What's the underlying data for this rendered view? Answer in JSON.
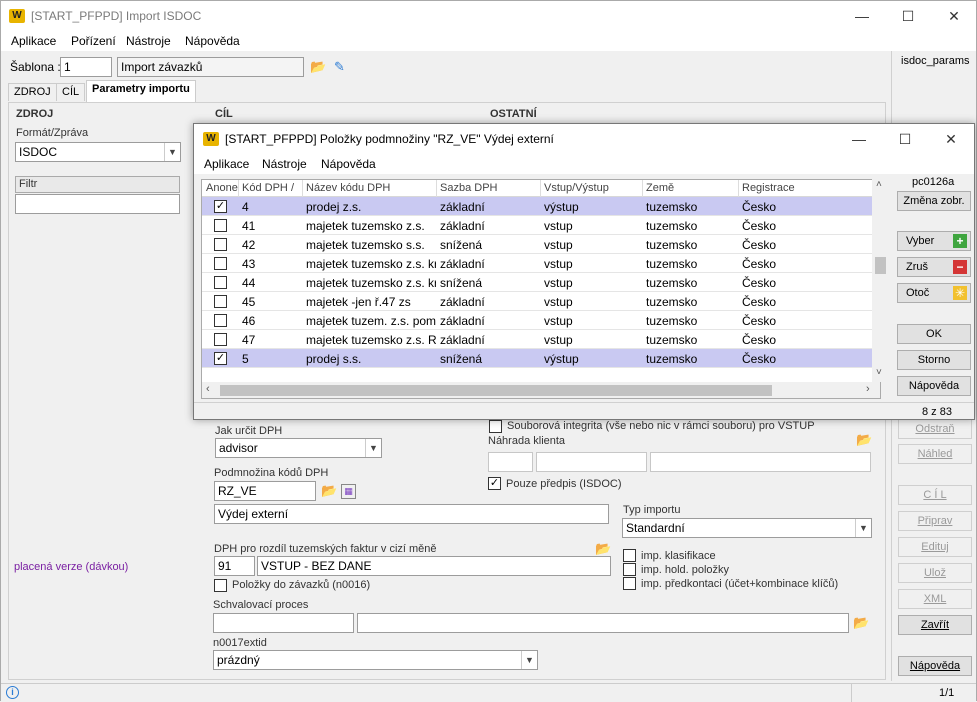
{
  "window": {
    "title": "[START_PFPPD] Import ISDOC",
    "logo": "W"
  },
  "menu": [
    "Aplikace",
    "Pořízení",
    "Nástroje",
    "Nápověda"
  ],
  "template": {
    "label": "Šablona :",
    "number": "1",
    "name": "Import závazků"
  },
  "right_top_label": "isdoc_params",
  "tabs": [
    "ZDROJ",
    "CÍL",
    "Parametry importu"
  ],
  "sections": {
    "zdroj": "ZDROJ",
    "cil": "CÍL",
    "ostatni": "OSTATNÍ"
  },
  "format": {
    "label": "Formát/Zpráva",
    "value": "ISDOC"
  },
  "filter": {
    "label": "Filtr",
    "value": ""
  },
  "paid_version": "placená verze (dávkou)",
  "dph_method": {
    "label": "Jak určit DPH",
    "value": "advisor"
  },
  "dph_subset": {
    "label": "Podmnožina kódů DPH",
    "code": "RZ_VE",
    "name": "Výdej externí"
  },
  "integrity": {
    "label": "Souborová integrita (vše nebo nic v rámci souboru) pro VSTUP",
    "checked": false
  },
  "client_replace": {
    "label": "Náhrada klienta",
    "v1": "",
    "v2": "",
    "v3": ""
  },
  "prescription_only": {
    "label": "Pouze předpis (ISDOC)",
    "checked": true
  },
  "import_type": {
    "label": "Typ importu",
    "value": "Standardní"
  },
  "foreign_dph": {
    "label": "DPH pro rozdíl tuzemských faktur v cizí měně",
    "code": "91",
    "name": "VSTUP  - BEZ DANE"
  },
  "items_to_invoices": {
    "label": "Položky do závazků (n0016)",
    "checked": false
  },
  "imp_checks": [
    {
      "label": "imp. klasifikace",
      "checked": false
    },
    {
      "label": "imp. hold. položky",
      "checked": false
    },
    {
      "label": "imp. předkontaci (účet+kombinace klíčů)",
      "checked": false
    }
  ],
  "approval": {
    "label": "Schvalovací proces",
    "v1": "",
    "v2": ""
  },
  "extid": {
    "label": "n0017extid",
    "value": "prázdný"
  },
  "right_buttons": {
    "odstran": "Odstraň",
    "nahled": "Náhled",
    "cil": "C Í L",
    "priprav": "Připrav",
    "edituj": "Edituj",
    "uloz": "Ulož",
    "xml": "XML",
    "zavrit": "Zavřít",
    "napoveda": "Nápověda"
  },
  "status": {
    "info_icon": "info-icon",
    "page": "1/1"
  },
  "dialog": {
    "title": "[START_PFPPD] Položky podmnožiny \"RZ_VE\" Výdej externí",
    "menu": [
      "Aplikace",
      "Nástroje",
      "Nápověda"
    ],
    "columns": [
      "Anone",
      "Kód DPH",
      "Název kódu DPH",
      "Sazba DPH",
      "Vstup/Výstup",
      "Země",
      "Registrace"
    ],
    "sort_indicator": "/",
    "rows": [
      {
        "checked": true,
        "code": "4",
        "name": "prodej z.s.",
        "rate": "základní",
        "dir": "výstup",
        "country": "tuzemsko",
        "reg": "Česko",
        "selected": true
      },
      {
        "checked": false,
        "code": "41",
        "name": "majetek tuzemsko z.s.",
        "rate": "základní",
        "dir": "vstup",
        "country": "tuzemsko",
        "reg": "Česko",
        "selected": false
      },
      {
        "checked": false,
        "code": "42",
        "name": "majetek tuzemsko s.s.",
        "rate": "snížená",
        "dir": "vstup",
        "country": "tuzemsko",
        "reg": "Česko",
        "selected": false
      },
      {
        "checked": false,
        "code": "43",
        "name": "majetek tuzemsko z.s. kráceně",
        "rate": "základní",
        "dir": "vstup",
        "country": "tuzemsko",
        "reg": "Česko",
        "selected": false
      },
      {
        "checked": false,
        "code": "44",
        "name": "majetek tuzemsko z.s. kráceně",
        "rate": "snížená",
        "dir": "vstup",
        "country": "tuzemsko",
        "reg": "Česko",
        "selected": false
      },
      {
        "checked": false,
        "code": "45",
        "name": "majetek -jen ř.47 zs",
        "rate": "základní",
        "dir": "vstup",
        "country": "tuzemsko",
        "reg": "Česko",
        "selected": false
      },
      {
        "checked": false,
        "code": "46",
        "name": "majetek tuzem. z.s. pomě",
        "rate": "základní",
        "dir": "vstup",
        "country": "tuzemsko",
        "reg": "Česko",
        "selected": false
      },
      {
        "checked": false,
        "code": "47",
        "name": "majetek tuzemsko z.s. Rz",
        "rate": "základní",
        "dir": "vstup",
        "country": "tuzemsko",
        "reg": "Česko",
        "selected": false
      },
      {
        "checked": true,
        "code": "5",
        "name": "prodej  s.s.",
        "rate": "snížená",
        "dir": "výstup",
        "country": "tuzemsko",
        "reg": "Česko",
        "selected": true
      }
    ],
    "side_label": "pc0126a",
    "buttons": {
      "change": "Změna zobr.",
      "select": "Vyber",
      "cancel_sel": "Zruš",
      "invert": "Otoč",
      "ok": "OK",
      "storno": "Storno",
      "help": "Nápověda"
    },
    "count": "8 z 83",
    "colors": {
      "selected_row": "#c9c9f2",
      "plus": "#3fa53f",
      "minus": "#d43535",
      "star": "#f2c12e"
    }
  }
}
